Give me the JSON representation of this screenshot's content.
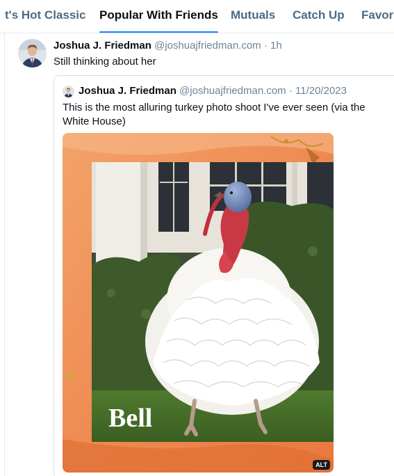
{
  "tabs": [
    {
      "label": "t's Hot Classic",
      "active": false
    },
    {
      "label": "Popular With Friends",
      "active": true
    },
    {
      "label": "Mutuals",
      "active": false
    },
    {
      "label": "Catch Up",
      "active": false
    },
    {
      "label": "Favori",
      "active": false
    }
  ],
  "post": {
    "author": "Joshua J. Friedman",
    "handle": "@joshuajfriedman.com",
    "separator": "·",
    "time": "1h",
    "text": "Still thinking about her"
  },
  "quote": {
    "author": "Joshua J. Friedman",
    "handle": "@joshuajfriedman.com",
    "separator": "·",
    "date": "11/20/2023",
    "text": "This is the most alluring turkey photo shoot I've ever seen (via the White House)",
    "image_caption": "Bell",
    "alt_badge": "ALT"
  },
  "colors": {
    "accent": "#1a83ff",
    "text": "#0b0f14",
    "muted": "#6f839a",
    "tab_inactive": "#4b6b86"
  }
}
